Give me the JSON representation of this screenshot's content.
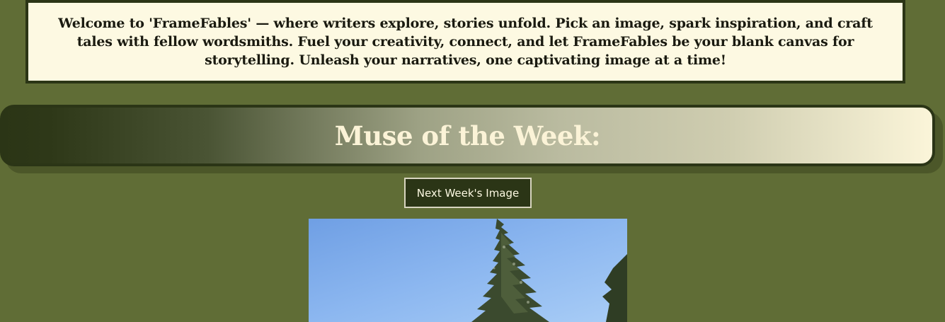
{
  "welcome": {
    "text": "Welcome to 'FrameFables' — where writers explore, stories unfold. Pick an image, spark inspiration, and craft tales with fellow wordsmiths. Fuel your creativity, connect, and let FrameFables be your blank canvas for storytelling. Unleash your narratives, one captivating image at a time!"
  },
  "muse": {
    "title": "Muse of the Week:"
  },
  "actions": {
    "next_week_label": "Next Week's Image"
  },
  "image": {
    "subject": "evergreen-tree-against-blue-sky"
  },
  "colors": {
    "page_background": "#606d36",
    "dark_green": "#2b3516",
    "cream": "#fdf9e2"
  }
}
